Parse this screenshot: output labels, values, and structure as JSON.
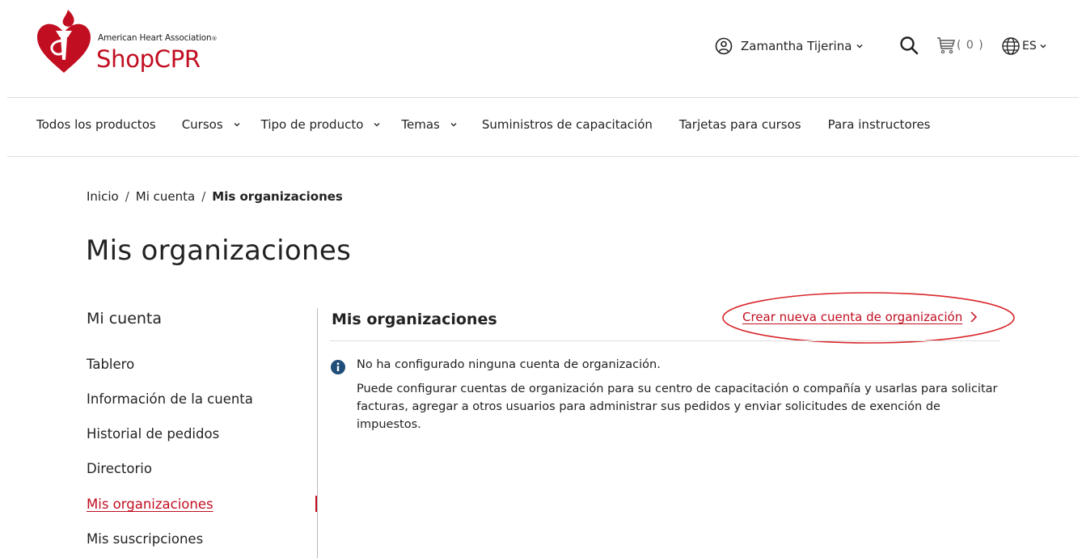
{
  "brand": {
    "org_name": "American Heart Association",
    "trademark": "®",
    "shop_name": "ShopCPR"
  },
  "header": {
    "user_name": "Zamantha Tijerina",
    "cart_count": "( 0 )",
    "language": "ES"
  },
  "nav": {
    "items": [
      {
        "label": "Todos los productos",
        "has_dropdown": false
      },
      {
        "label": "Cursos",
        "has_dropdown": true
      },
      {
        "label": "Tipo de producto",
        "has_dropdown": true
      },
      {
        "label": "Temas",
        "has_dropdown": true
      },
      {
        "label": "Suministros de capacitación",
        "has_dropdown": false
      },
      {
        "label": "Tarjetas para cursos",
        "has_dropdown": false
      },
      {
        "label": "Para instructores",
        "has_dropdown": false
      }
    ]
  },
  "breadcrumb": {
    "items": [
      "Inicio",
      "Mi cuenta",
      "Mis organizaciones"
    ],
    "separator": "/"
  },
  "page": {
    "title": "Mis organizaciones"
  },
  "sidebar": {
    "heading": "Mi cuenta",
    "items": [
      {
        "label": "Tablero",
        "active": false
      },
      {
        "label": "Información de la cuenta",
        "active": false
      },
      {
        "label": "Historial de pedidos",
        "active": false
      },
      {
        "label": "Directorio",
        "active": false
      },
      {
        "label": "Mis organizaciones",
        "active": true
      },
      {
        "label": "Mis suscripciones",
        "active": false
      }
    ]
  },
  "main": {
    "title": "Mis organizaciones",
    "create_link": "Crear nueva cuenta de organización",
    "info_title": "No ha configurado ninguna cuenta de organización.",
    "info_text": "Puede configurar cuentas de organización para su centro de capacitación o compañía y usarlas para solicitar facturas, agregar a otros usuarios para administrar sus pedidos y enviar solicitudes de exención de impuestos."
  },
  "colors": {
    "brand_red": "#c10e21",
    "info_blue": "#1f4e79",
    "text": "#222222",
    "divider": "#dddddd",
    "highlight": "#d9262b"
  }
}
